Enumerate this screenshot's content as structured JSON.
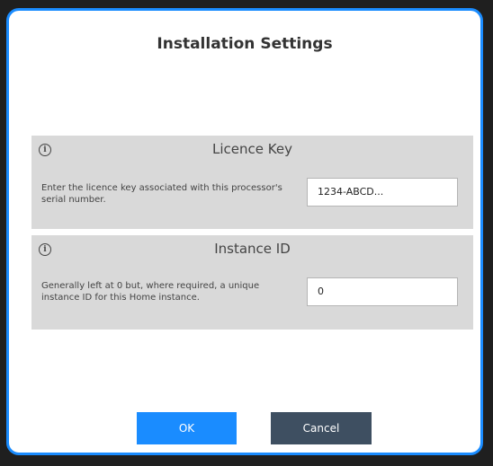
{
  "dialog": {
    "title": "Installation Settings",
    "ok_label": "OK",
    "cancel_label": "Cancel",
    "accent_color": "#1a8cff",
    "cancel_color": "#3e4f61"
  },
  "panels": [
    {
      "icon": "info-icon",
      "title": "Licence Key",
      "description": "Enter the licence key associated with this processor's serial number.",
      "value": "1234-ABCD..."
    },
    {
      "icon": "info-icon",
      "title": "Instance ID",
      "description": "Generally left at 0 but, where required, a unique instance ID for this Home instance.",
      "value": "0"
    }
  ]
}
